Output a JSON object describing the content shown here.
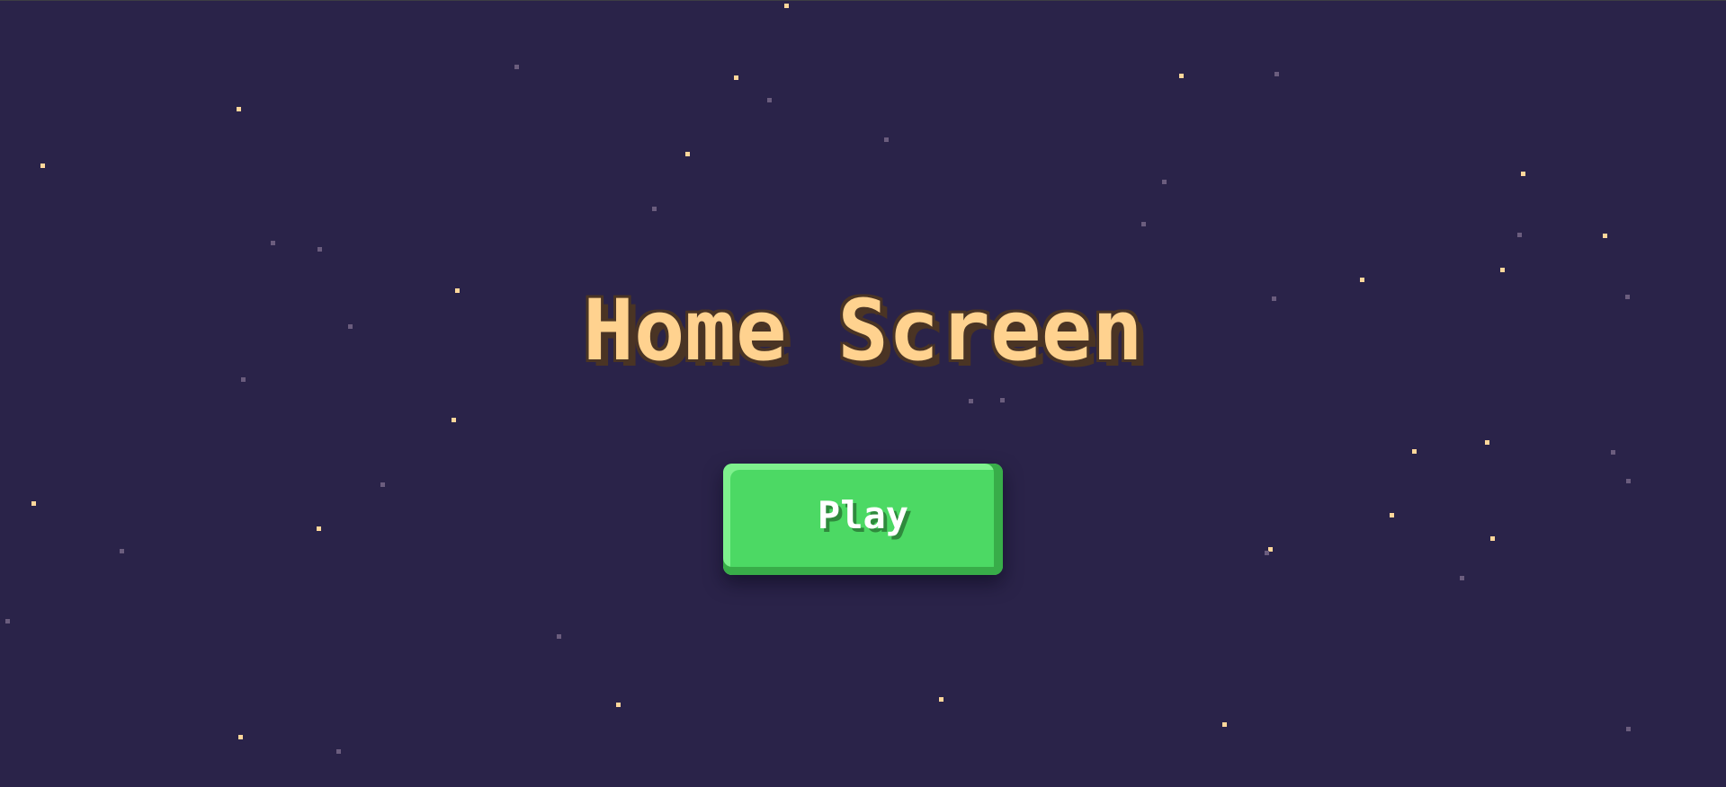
{
  "screen": {
    "title": "Home Screen",
    "background_color": "#2a2349",
    "title_color": "#ffd28f",
    "title_outline_color": "#4a3424"
  },
  "play_button": {
    "label": "Play",
    "color": "#4cd964",
    "shadow_color": "#38ad49",
    "label_color": "#ffffff"
  },
  "stars": {
    "bright_color": "#ffd79b",
    "dim_color": "#6b5d7e"
  }
}
